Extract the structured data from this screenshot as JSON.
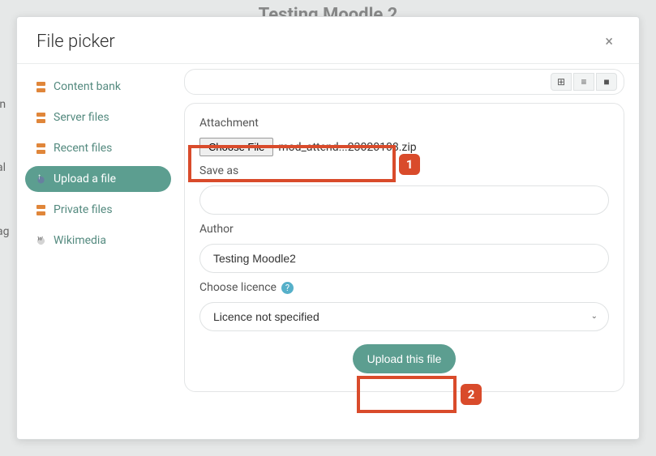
{
  "bg": {
    "title_hint": "Testing Moodle 2",
    "left_letters": "in\n\nal\n\nag"
  },
  "modal": {
    "title": "File picker",
    "close_glyph": "×"
  },
  "sidebar": {
    "items": [
      {
        "label": "Content bank",
        "icon": "bank-icon"
      },
      {
        "label": "Server files",
        "icon": "server-icon"
      },
      {
        "label": "Recent files",
        "icon": "recent-icon"
      },
      {
        "label": "Upload a file",
        "icon": "upload-icon",
        "active": true
      },
      {
        "label": "Private files",
        "icon": "private-icon"
      },
      {
        "label": "Wikimedia",
        "icon": "wiki-icon"
      }
    ]
  },
  "views": {
    "grid_glyph": "⊞",
    "list_glyph": "≡",
    "tree_glyph": "■"
  },
  "form": {
    "attachment_label": "Attachment",
    "choose_file_label": "Choose File",
    "chosen_file": "mod_attend...23020108.zip",
    "save_as_label": "Save as",
    "save_as_value": "",
    "author_label": "Author",
    "author_value": "Testing Moodle2",
    "licence_label": "Choose licence",
    "licence_value": "Licence not specified",
    "help_glyph": "?",
    "upload_button": "Upload this file"
  },
  "annotations": {
    "step1": "1",
    "step2": "2"
  }
}
